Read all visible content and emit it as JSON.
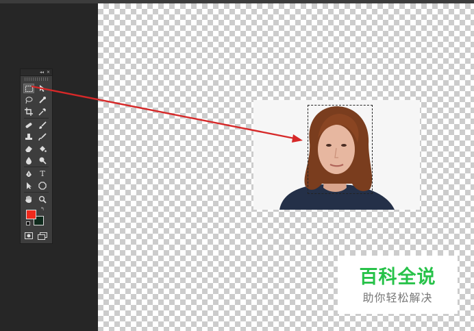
{
  "toolbox": {
    "header_buttons": [
      "◂◂",
      "✕"
    ],
    "tools": [
      {
        "name": "rectangular-marquee-tool",
        "active": true
      },
      {
        "name": "move-tool",
        "active": false
      },
      {
        "name": "lasso-tool",
        "active": false
      },
      {
        "name": "quick-selection-tool",
        "active": false
      },
      {
        "name": "crop-tool",
        "active": false
      },
      {
        "name": "eyedropper-tool",
        "active": false
      },
      {
        "name": "spot-healing-brush-tool",
        "active": false
      },
      {
        "name": "brush-tool",
        "active": false
      },
      {
        "name": "clone-stamp-tool",
        "active": false
      },
      {
        "name": "history-brush-tool",
        "active": false
      },
      {
        "name": "eraser-tool",
        "active": false
      },
      {
        "name": "paint-bucket-tool",
        "active": false
      },
      {
        "name": "blur-tool",
        "active": false
      },
      {
        "name": "dodge-tool",
        "active": false
      },
      {
        "name": "pen-tool",
        "active": false
      },
      {
        "name": "type-tool",
        "active": false
      },
      {
        "name": "path-selection-tool",
        "active": false
      },
      {
        "name": "shape-tool",
        "active": false
      },
      {
        "name": "hand-tool",
        "active": false
      },
      {
        "name": "zoom-tool",
        "active": false
      }
    ],
    "type_tool_glyph": "T",
    "foreground_color": "#f0291c",
    "background_color": "#0f2a1c"
  },
  "annotation": {
    "arrow_color": "#d62828"
  },
  "watermark": {
    "title": "百科全说",
    "subtitle": "助你轻松解决",
    "title_color": "#27c249"
  }
}
